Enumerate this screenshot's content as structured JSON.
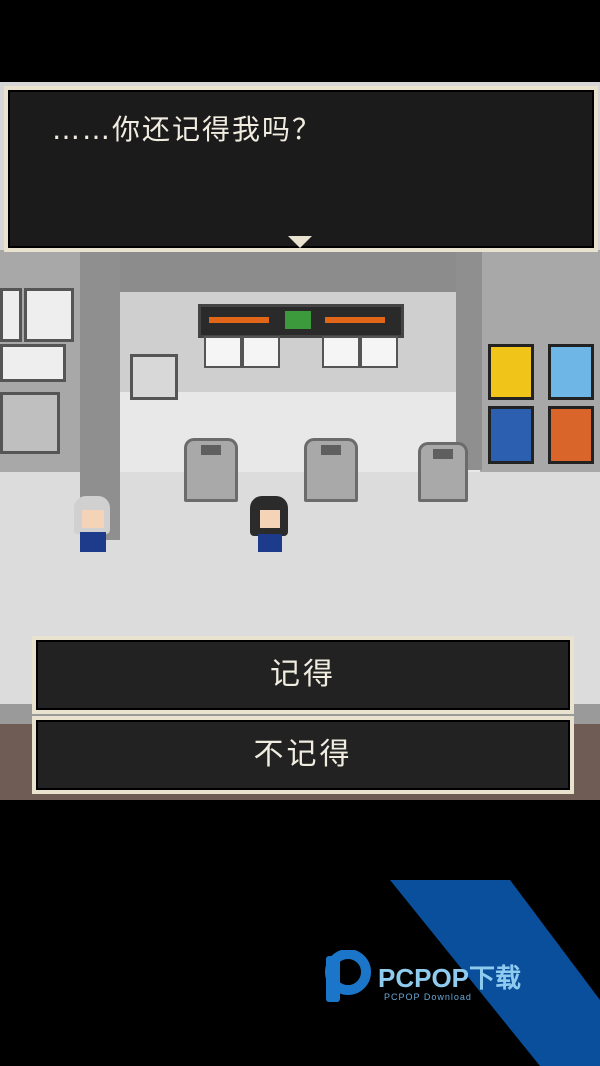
{
  "dialog": {
    "text": "……你还记得我吗？"
  },
  "choices": [
    {
      "label": "记得"
    },
    {
      "label": "不记得"
    }
  ],
  "watermark": {
    "brand": "PCPOP下载",
    "sub": "PCPOP Download"
  },
  "colors": {
    "frame": "#e8e2cf",
    "panel": "#1b1b1b",
    "text": "#f0ece0",
    "watermark": "#0a4f9c"
  }
}
